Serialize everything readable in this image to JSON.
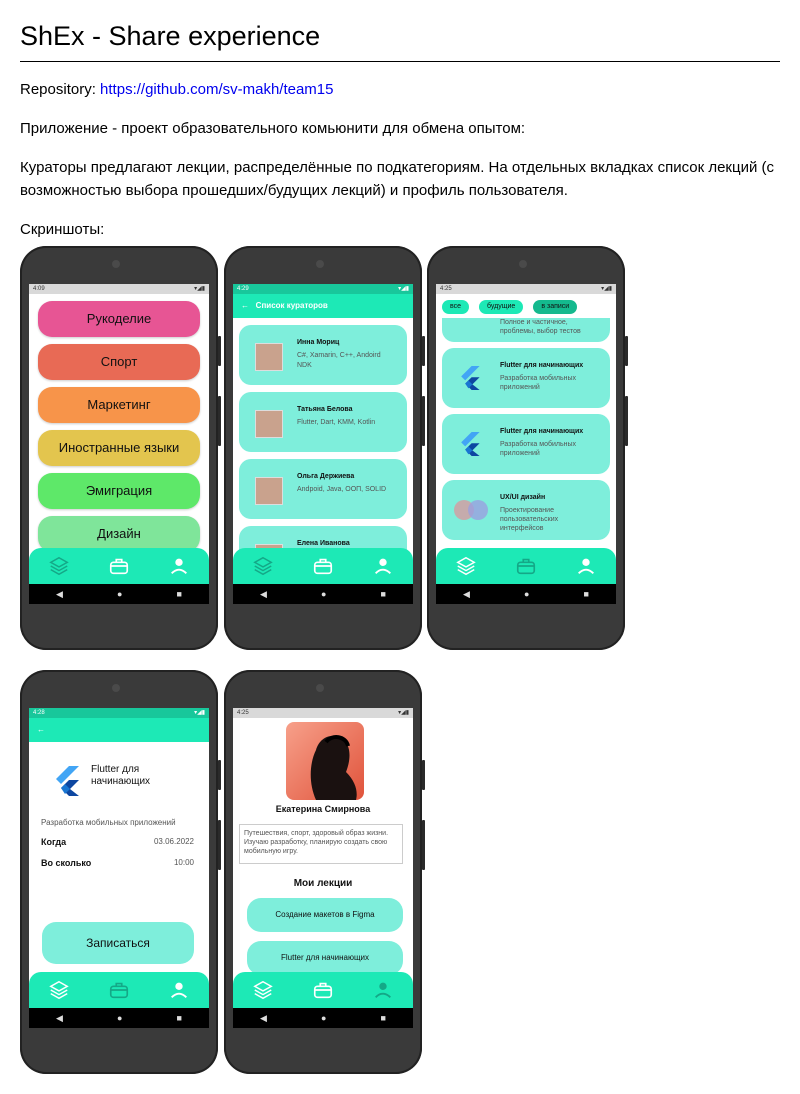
{
  "title": "ShEx - Share experience",
  "repo": {
    "label": "Repository:",
    "link": "https://github.com/sv-makh/team15"
  },
  "intro": "Приложение - проект образовательного комьюнити для обмена опытом:",
  "description": "Кураторы предлагают лекции, распределённые по подкатегориям. На отдельных вкладках список лекций (с возможностью выбора прошедших/будущих лекций) и профиль пользователя.",
  "screenshots_label": "Скриншоты:",
  "phone1": {
    "status_time": "4:09",
    "categories": [
      {
        "label": "Рукоделие",
        "color": "#e75594"
      },
      {
        "label": "Спорт",
        "color": "#e86a55"
      },
      {
        "label": "Маркетинг",
        "color": "#f7944a"
      },
      {
        "label": "Иностранные языки",
        "color": "#e3c54e"
      },
      {
        "label": "Эмиграция",
        "color": "#5ee869"
      },
      {
        "label": "Дизайн",
        "color": "#7fe59a"
      }
    ]
  },
  "phone2": {
    "status_time": "4:29",
    "appbar_title": "Список кураторов",
    "curators": [
      {
        "name": "Инна Мориц",
        "skills": "C#, Xamarin, C++, Andoird NDK"
      },
      {
        "name": "Татьяна Белова",
        "skills": "Flutter, Dart, KMM, Kotlin"
      },
      {
        "name": "Ольга Держиева",
        "skills": "Andpoid, Java, ООП, SOLID"
      },
      {
        "name": "Елена Иванова",
        "skills": ""
      }
    ]
  },
  "phone3": {
    "status_time": "4:25",
    "chips": [
      "все",
      "будущие",
      "в записи"
    ],
    "top_partial": "Полное и частичное, проблемы, выбор тестов",
    "lectures": [
      {
        "title": "Flutter для начинающих",
        "desc": "Разработка мобильных приложений"
      },
      {
        "title": "Flutter для начинающих",
        "desc": "Разработка мобильных приложений"
      },
      {
        "title": "UX/UI дизайн",
        "desc": "Проектирование пользовательских интерфейсов"
      }
    ]
  },
  "phone4": {
    "status_time": "4:28",
    "lecture_title": "Flutter для начинающих",
    "subtitle": "Разработка мобильных приложений",
    "when_label": "Когда",
    "when_value": "03.06.2022",
    "time_label": "Во сколько",
    "time_value": "10:00",
    "signup_label": "Записаться"
  },
  "phone5": {
    "status_time": "4:25",
    "name": "Екатерина Смирнова",
    "bio": "Путешествия, спорт, здоровый образ жизни. Изучаю разработку, планирую создать свою мобильную игру.",
    "my_lectures_label": "Мои лекции",
    "lectures": [
      "Создание макетов в Figma",
      "Flutter для начинающих"
    ]
  },
  "icons": {
    "tab1": "layers-icon",
    "tab2": "briefcase-icon",
    "tab3": "profile-icon"
  },
  "colors": {
    "accent": "#1de9b6",
    "card": "#7eeedb"
  }
}
